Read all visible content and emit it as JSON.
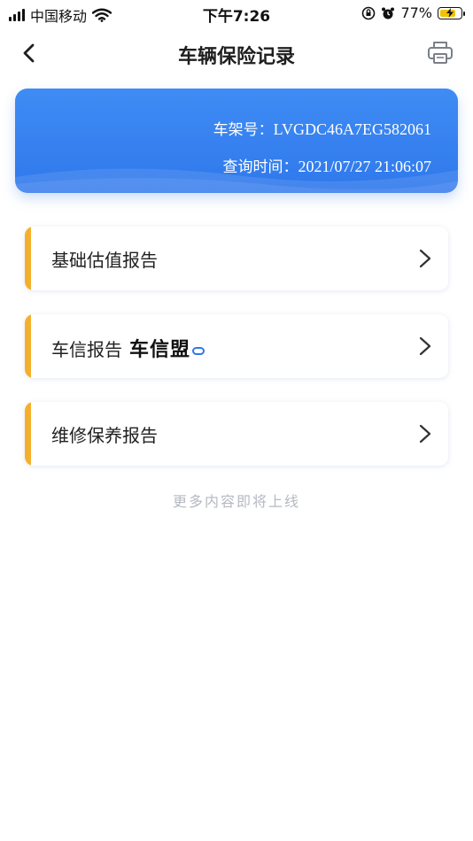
{
  "status_bar": {
    "carrier": "中国移动",
    "time": "下午7:26",
    "battery_percent": "77%",
    "battery_level": 0.77,
    "icons": [
      "signal-icon",
      "wifi-icon",
      "rotation-lock-icon",
      "alarm-icon",
      "battery-charging-icon"
    ]
  },
  "nav": {
    "title": "车辆保险记录",
    "back_icon": "chevron-left-icon",
    "print_icon": "printer-icon"
  },
  "info_card": {
    "vin_label": "车架号：",
    "vin_value": "LVGDC46A7EG582061",
    "time_label": "查询时间：",
    "time_value": "2021/07/27 21:06:07"
  },
  "reports": [
    {
      "label": "基础估值报告"
    },
    {
      "label": "车信报告",
      "brand": "车信盟"
    },
    {
      "label": "维修保养报告"
    }
  ],
  "footer_note": "更多内容即将上线",
  "colors": {
    "accent_blue": "#2f78ec",
    "accent_orange": "#f4b02c",
    "muted_text": "#b5b9c2"
  }
}
